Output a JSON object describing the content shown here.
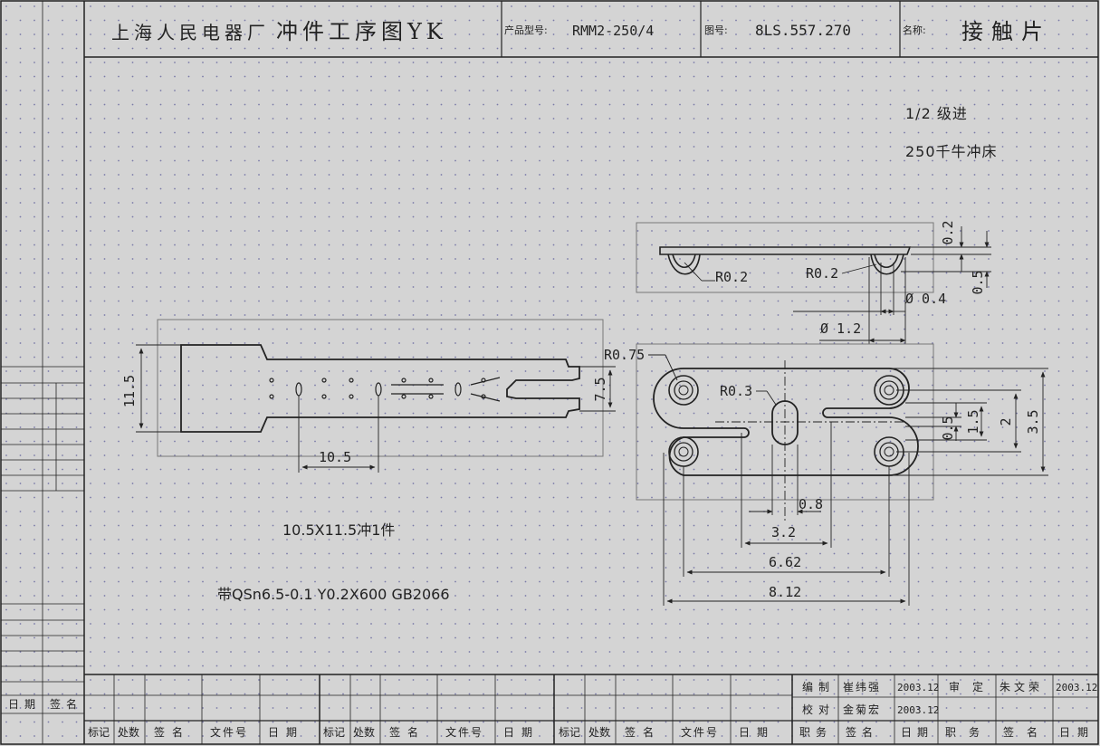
{
  "title_block": {
    "factory": "上海人民电器厂",
    "doc_title": "冲件工序图YK",
    "product_model_label": "产品型号:",
    "product_model": "RMM2-250/4",
    "drawing_no_label": "图号:",
    "drawing_no": "8LS.557.270",
    "name_label": "名称:",
    "name": "接触片"
  },
  "notes": {
    "progression": "1/2 级进",
    "press": "250千牛冲床",
    "blank_note": "10.5X11.5冲1件",
    "material": "带QSn6.5-0.1 Y0.2X600 GB2066"
  },
  "dimensions": {
    "side_view": [
      "0.2",
      "R0.2",
      "R0.2",
      "0.5",
      "Ø 0.4",
      "Ø 1.2"
    ],
    "strip": [
      "11.5",
      "7.5",
      "10.5"
    ],
    "top_view": [
      "R0.75",
      "R0.3",
      "0.5",
      "1.5",
      "2",
      "3.5",
      "0.8",
      "3.2",
      "6.62",
      "8.12"
    ]
  },
  "left_margin": {
    "date_label": "日期",
    "sign_label": "签名"
  },
  "revision_headers": [
    "标记",
    "处数",
    "签名",
    "文件号",
    "日期"
  ],
  "approval": {
    "row1": [
      "编制",
      "崔纬强",
      "2003.12",
      "审定",
      "朱文荣",
      "2003.12"
    ],
    "row2": [
      "校对",
      "金菊宏",
      "2003.12"
    ],
    "row3": [
      "职务",
      "签名",
      "日期",
      "职务",
      "签名",
      "日期"
    ]
  }
}
